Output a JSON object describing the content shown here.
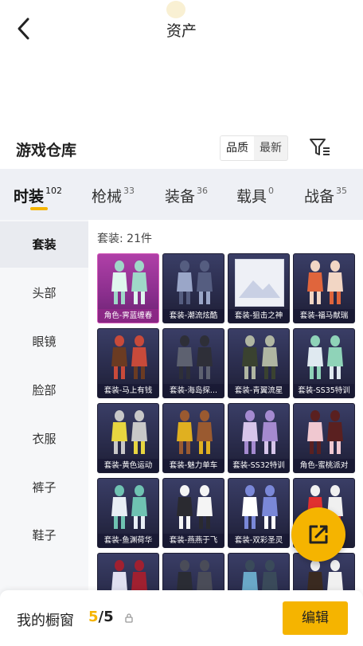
{
  "header": {
    "title": "资产"
  },
  "warehouse": {
    "title": "游戏仓库",
    "sort_options": [
      "品质",
      "最新"
    ]
  },
  "tabs": [
    {
      "label": "时装",
      "count": "102"
    },
    {
      "label": "枪械",
      "count": "33"
    },
    {
      "label": "装备",
      "count": "36"
    },
    {
      "label": "载具",
      "count": "0"
    },
    {
      "label": "战备",
      "count": "35"
    }
  ],
  "sidebar": {
    "items": [
      "套装",
      "头部",
      "眼镜",
      "脸部",
      "衣服",
      "裤子",
      "鞋子"
    ]
  },
  "content": {
    "count_label": "套装: 21件",
    "items": [
      {
        "name": "角色-霁蓝缠春"
      },
      {
        "name": "套装-潮流炫酷"
      },
      {
        "name": "套装-狙击之神"
      },
      {
        "name": "套装-福马献瑞"
      },
      {
        "name": "套装-马上有钱"
      },
      {
        "name": "套装-海岛探..."
      },
      {
        "name": "套装-青翼流星"
      },
      {
        "name": "套装-SS35特训"
      },
      {
        "name": "套装-黄色运动"
      },
      {
        "name": "套装-魅力单车"
      },
      {
        "name": "套装-SS32特训"
      },
      {
        "name": "角色-蜜桃派对"
      },
      {
        "name": "套装-鱼渊荷华"
      },
      {
        "name": "套装-燕燕于飞"
      },
      {
        "name": "套装-双彩圣灵"
      },
      {
        "name": ""
      },
      {
        "name": ""
      },
      {
        "name": ""
      },
      {
        "name": ""
      },
      {
        "name": ""
      }
    ]
  },
  "bottom": {
    "showcase_label": "我的橱窗",
    "current": "5",
    "separator": "/",
    "total": "5",
    "edit_label": "编辑"
  },
  "colors": {
    "accent": "#f5b400",
    "card_bg": "#2a2c4c",
    "featured_card": "#a13a9c"
  }
}
